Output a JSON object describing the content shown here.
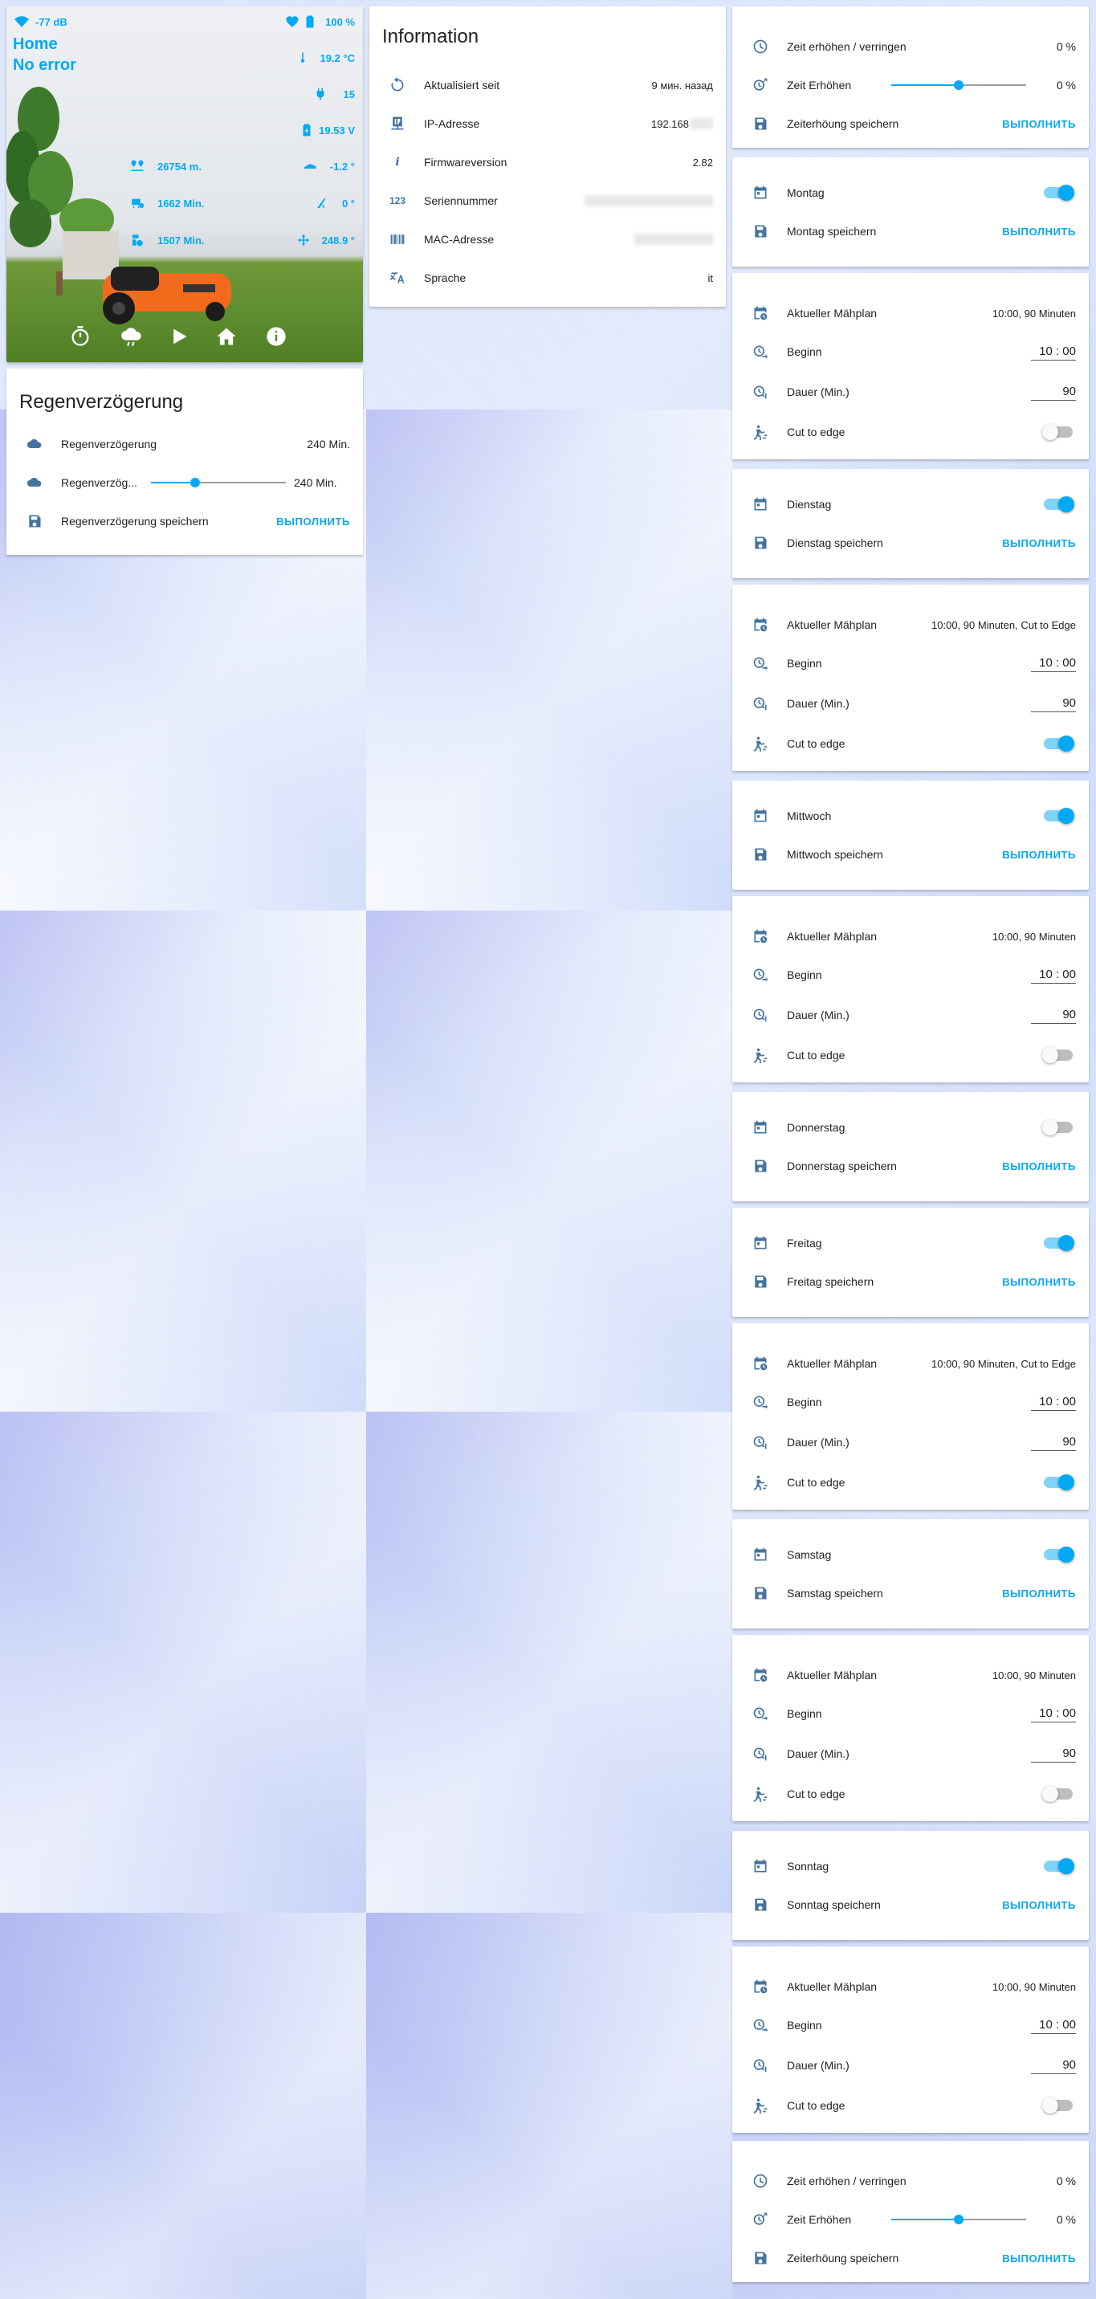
{
  "mower": {
    "wifi": "-77 dB",
    "battery": "100 %",
    "name": "Home",
    "status": "No error",
    "temperature": "19.2 °C",
    "charge_cycles": "15",
    "voltage": "19.53 V",
    "distance": "26754 m.",
    "pitch": "-1.2 °",
    "blade_time": "1662 Min.",
    "roll": "0 °",
    "work_time": "1507 Min.",
    "yaw": "248.9 °"
  },
  "rain": {
    "title": "Regenverzögerung",
    "rows": [
      {
        "label": "Regenverzögerung",
        "value": "240 Min."
      },
      {
        "label": "Regenverzög...",
        "value": "240 Min.",
        "slider": 0.33
      },
      {
        "label": "Regenverzögerung speichern",
        "action": "ВЫПОЛНИТЬ"
      }
    ]
  },
  "info": {
    "title": "Information",
    "rows": [
      {
        "label": "Aktualisiert seit",
        "value": "9 мин. назад"
      },
      {
        "label": "IP-Adresse",
        "value": "192.168"
      },
      {
        "label": "Firmwareversion",
        "value": "2.82"
      },
      {
        "label": "Seriennummer",
        "value": ""
      },
      {
        "label": "MAC-Adresse",
        "value": ""
      },
      {
        "label": "Sprache",
        "value": "it"
      }
    ],
    "icon_123": "123"
  },
  "timeadj": {
    "rows": [
      {
        "label": "Zeit erhöhen / verringen",
        "value": "0 %"
      },
      {
        "label": "Zeit Erhöhen",
        "value": "0 %",
        "slider": 0.5
      },
      {
        "label": "Zeiterhöung speichern",
        "action": "ВЫПОЛНИТЬ"
      }
    ]
  },
  "days": [
    {
      "day": "Montag",
      "on": true,
      "save": "Montag speichern",
      "action": "ВЫПОЛНИТЬ",
      "plan_label": "Aktueller Mähplan",
      "plan": "10:00, 90 Minuten",
      "begin_label": "Beginn",
      "begin": "10 : 00",
      "dur_label": "Dauer (Min.)",
      "dur": "90",
      "cut_label": "Cut to edge",
      "cut": false
    },
    {
      "day": "Dienstag",
      "on": true,
      "save": "Dienstag speichern",
      "action": "ВЫПОЛНИТЬ",
      "plan_label": "Aktueller Mähplan",
      "plan": "10:00, 90 Minuten, Cut to Edge",
      "begin_label": "Beginn",
      "begin": "10 : 00",
      "dur_label": "Dauer (Min.)",
      "dur": "90",
      "cut_label": "Cut to edge",
      "cut": true
    },
    {
      "day": "Mittwoch",
      "on": true,
      "save": "Mittwoch speichern",
      "action": "ВЫПОЛНИТЬ",
      "plan_label": "Aktueller Mähplan",
      "plan": "10:00, 90 Minuten",
      "begin_label": "Beginn",
      "begin": "10 : 00",
      "dur_label": "Dauer (Min.)",
      "dur": "90",
      "cut_label": "Cut to edge",
      "cut": false
    },
    {
      "day": "Donnerstag",
      "on": false,
      "save": "Donnerstag speichern",
      "action": "ВЫПОЛНИТЬ"
    },
    {
      "day": "Freitag",
      "on": true,
      "save": "Freitag speichern",
      "action": "ВЫПОЛНИТЬ",
      "plan_label": "Aktueller Mähplan",
      "plan": "10:00, 90 Minuten, Cut to Edge",
      "begin_label": "Beginn",
      "begin": "10 : 00",
      "dur_label": "Dauer (Min.)",
      "dur": "90",
      "cut_label": "Cut to edge",
      "cut": true
    },
    {
      "day": "Samstag",
      "on": true,
      "save": "Samstag speichern",
      "action": "ВЫПОЛНИТЬ",
      "plan_label": "Aktueller Mähplan",
      "plan": "10:00, 90 Minuten",
      "begin_label": "Beginn",
      "begin": "10 : 00",
      "dur_label": "Dauer (Min.)",
      "dur": "90",
      "cut_label": "Cut to edge",
      "cut": false
    },
    {
      "day": "Sonntag",
      "on": true,
      "save": "Sonntag speichern",
      "action": "ВЫПОЛНИТЬ",
      "plan_label": "Aktueller Mähplan",
      "plan": "10:00, 90 Minuten",
      "begin_label": "Beginn",
      "begin": "10 : 00",
      "dur_label": "Dauer (Min.)",
      "dur": "90",
      "cut_label": "Cut to edge",
      "cut": false
    }
  ],
  "colors": {
    "accent": "#03a9f4",
    "icon": "#44739e"
  }
}
